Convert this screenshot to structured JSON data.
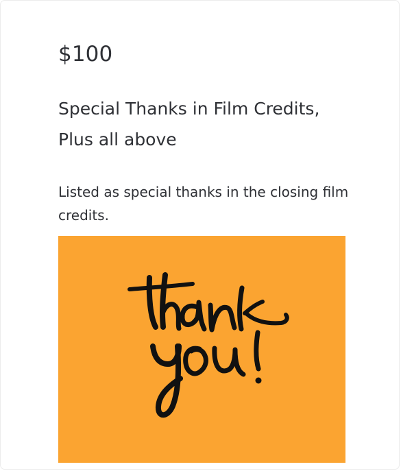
{
  "reward": {
    "price": "$100",
    "title": "Special Thanks in Film Credits, Plus all above",
    "description": "Listed as special thanks in the closing film credits.",
    "image": {
      "background_color": "#fba431",
      "handwritten_text": "thank you!"
    }
  },
  "colors": {
    "text": "#2f3136",
    "card_border": "#ececec",
    "image_background": "#fba431",
    "ink": "#111111"
  }
}
